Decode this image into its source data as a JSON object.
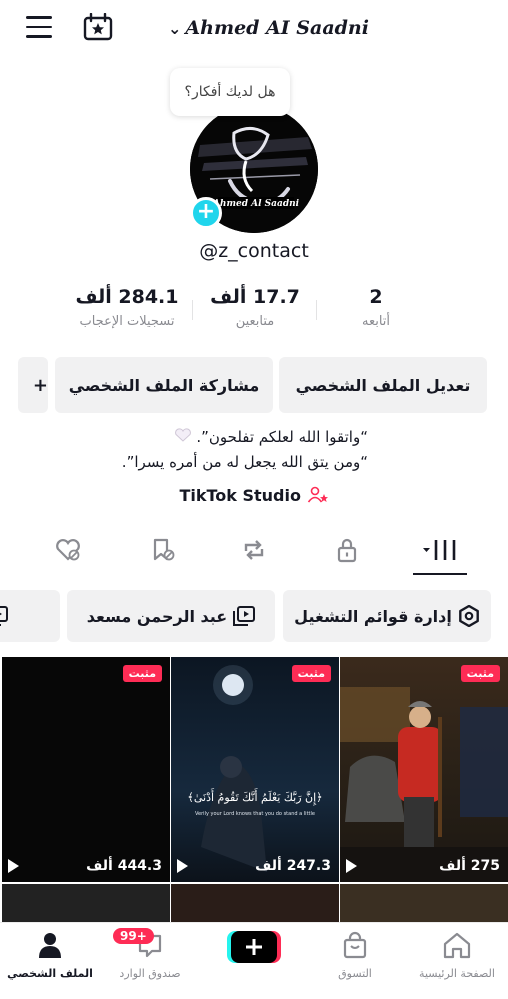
{
  "header": {
    "username": "Ahmed AI Saadni",
    "menu_icon": "hamburger-icon",
    "calendar_icon": "calendar-star-icon"
  },
  "bubble": {
    "text": "هل لديك أفكار؟"
  },
  "profile": {
    "handle": "@z_contact",
    "avatar_text": "Ahmed Al Saadni"
  },
  "stats": {
    "likes": {
      "value": "284.1 ألف",
      "label": "تسجيلات الإعجاب"
    },
    "followers": {
      "value": "17.7 ألف",
      "label": "متابعين"
    },
    "following": {
      "value": "2",
      "label": "أتابعه"
    }
  },
  "buttons": {
    "edit_profile": "تعديل الملف الشخصي",
    "share_profile": "مشاركة الملف الشخصي",
    "add_friend": "+"
  },
  "bio": {
    "line1": "“واتقوا الله لعلكم تفلحون”.",
    "line2": "“ومن يتق الله يجعل له من أمره يسرا”."
  },
  "studio": {
    "label": "TikTok Studio"
  },
  "chips": {
    "playlists": "إدارة قوائم التشغيل",
    "playlist_1": "عبد الرحمن مسعد"
  },
  "videos": [
    {
      "pinned": "مثبت",
      "views": "275 ألف"
    },
    {
      "pinned": "مثبت",
      "views": "247.3 ألف",
      "overlay": "﴿إِنَّ رَبَّكَ يَعْلَمُ أَنَّكَ تَقُومُ أَدْنَىٰ﴾",
      "caption": "Verily your Lord knows that you do stand a little"
    },
    {
      "pinned": "مثبت",
      "views": "444.3 ألف"
    }
  ],
  "nav": {
    "home": "الصفحة الرئيسية",
    "shop": "التسوق",
    "inbox": "صندوق الوارد",
    "profile": "الملف الشخصي",
    "inbox_badge": "99+"
  },
  "colors": {
    "accent": "#fe2c55",
    "cyan": "#20d5ec",
    "button_bg": "#f1f1f2",
    "text": "#161823",
    "muted": "#8a8b91"
  }
}
